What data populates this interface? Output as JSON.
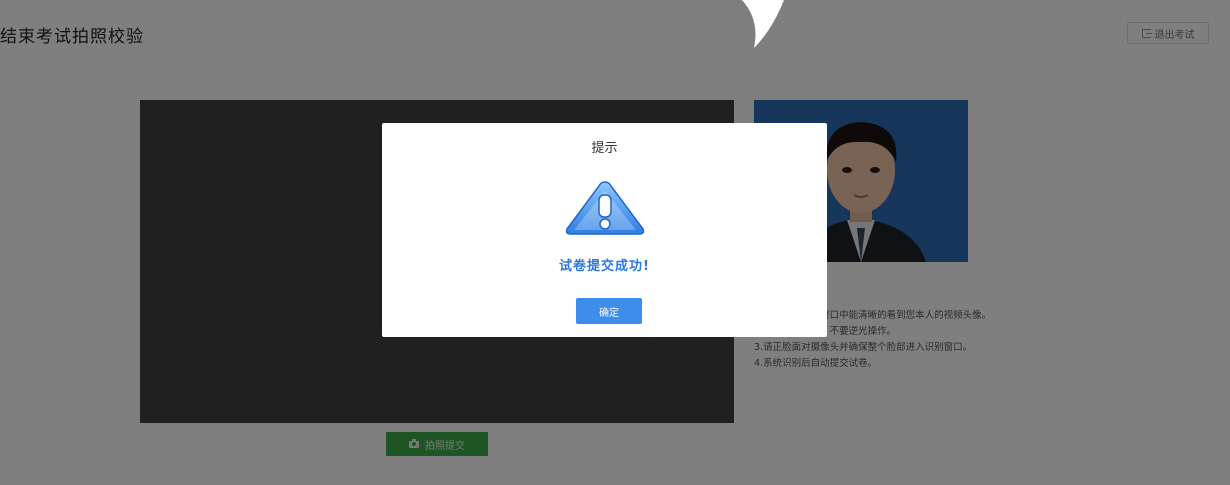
{
  "header": {
    "title": "结束考试拍照校验",
    "exit_button": "退出考试"
  },
  "camera": {
    "capture_button": "拍照提交"
  },
  "instructions": [
    "1.请确保在识别窗口中能清晰的看到您本人的视频头像。",
    "2.保证光线充足，不要逆光操作。",
    "3.请正脸面对摄像头并确保整个脸部进入识别窗口。",
    "4.系统识别后自动提交试卷。"
  ],
  "dialog": {
    "title": "提示",
    "message": "试卷提交成功!",
    "ok_button": "确定"
  },
  "icons": {
    "warning": "warning-triangle-icon",
    "camera": "camera-icon",
    "exit": "exit-icon"
  },
  "colors": {
    "accent_blue": "#3d8eea",
    "success_green": "#3fa94a",
    "message_blue": "#2f78d7"
  }
}
